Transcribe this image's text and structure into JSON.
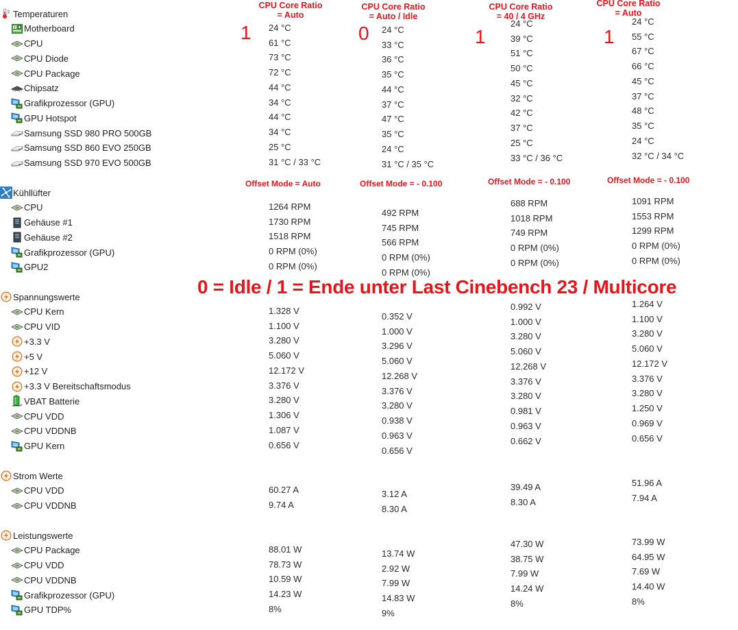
{
  "colors": {
    "annotation_red": "#e8141b",
    "text": "#1e1e1e"
  },
  "columns": [
    {
      "ratio_header": "CPU Core Ratio",
      "ratio_value": "= Auto",
      "marker": "1",
      "offset_label": "Offset Mode = Auto"
    },
    {
      "ratio_header": "CPU Core Ratio",
      "ratio_value": "= Auto / Idle",
      "marker": "0",
      "offset_label": "Offset Mode = - 0.100"
    },
    {
      "ratio_header": "CPU Core Ratio",
      "ratio_value": "= 40 / 4 GHz",
      "marker": "1",
      "offset_label": "Offset Mode = - 0.100"
    },
    {
      "ratio_header": "CPU Core Ratio",
      "ratio_value": "= Auto",
      "marker": "1",
      "offset_label": "Offset Mode = - 0.100"
    }
  ],
  "legend": "0 = Idle / 1 = Ende unter Last Cinebench 23 / Multicore",
  "sections": [
    {
      "title": "Temperaturen",
      "icon": "thermometer-icon",
      "items": [
        {
          "label": "Motherboard",
          "icon": "motherboard-icon",
          "values": [
            "24 °C",
            "24 °C",
            "24 °C",
            "24 °C"
          ]
        },
        {
          "label": "CPU",
          "icon": "cpu-icon",
          "values": [
            "61 °C",
            "33 °C",
            "39 °C",
            "55 °C"
          ]
        },
        {
          "label": "CPU Diode",
          "icon": "cpu-icon",
          "values": [
            "73 °C",
            "36 °C",
            "51 °C",
            "67 °C"
          ]
        },
        {
          "label": "CPU Package",
          "icon": "cpu-icon",
          "values": [
            "72 °C",
            "35 °C",
            "50 °C",
            "66 °C"
          ]
        },
        {
          "label": "Chipsatz",
          "icon": "chipset-icon",
          "values": [
            "44 °C",
            "44 °C",
            "45 °C",
            "45 °C"
          ]
        },
        {
          "label": "Grafikprozessor (GPU)",
          "icon": "gpu-icon",
          "values": [
            "34 °C",
            "37 °C",
            "32 °C",
            "37 °C"
          ]
        },
        {
          "label": "GPU Hotspot",
          "icon": "gpu-icon",
          "values": [
            "44 °C",
            "47 °C",
            "42 °C",
            "48 °C"
          ]
        },
        {
          "label": "Samsung SSD 980 PRO 500GB",
          "icon": "drive-icon",
          "values": [
            "34 °C",
            "35 °C",
            "37 °C",
            "35 °C"
          ]
        },
        {
          "label": "Samsung SSD 860 EVO 250GB",
          "icon": "drive-icon",
          "values": [
            "25 °C",
            "24 °C",
            "25 °C",
            "24 °C"
          ]
        },
        {
          "label": "Samsung SSD 970 EVO 500GB",
          "icon": "drive-icon",
          "values": [
            "31 °C / 33 °C",
            "31 °C / 35 °C",
            "33 °C / 36 °C",
            "32 °C / 34 °C"
          ]
        }
      ]
    },
    {
      "title": "Kühllüfter",
      "icon": "fan-icon",
      "items": [
        {
          "label": "CPU",
          "icon": "cpu-icon",
          "values": [
            "1264 RPM",
            "492 RPM",
            "688 RPM",
            "1091 RPM"
          ]
        },
        {
          "label": "Gehäuse #1",
          "icon": "case-icon",
          "values": [
            "1730 RPM",
            "745 RPM",
            "1018 RPM",
            "1553 RPM"
          ]
        },
        {
          "label": "Gehäuse #2",
          "icon": "case-icon",
          "values": [
            "1518 RPM",
            "566 RPM",
            "749 RPM",
            "1299 RPM"
          ]
        },
        {
          "label": "Grafikprozessor (GPU)",
          "icon": "gpu-icon",
          "values": [
            "0 RPM  (0%)",
            "0 RPM  (0%)",
            "0 RPM  (0%)",
            "0 RPM  (0%)"
          ]
        },
        {
          "label": "GPU2",
          "icon": "gpu-icon",
          "values": [
            "0 RPM  (0%)",
            "0 RPM  (0%)",
            "0 RPM  (0%)",
            "0 RPM  (0%)"
          ]
        }
      ]
    },
    {
      "title": "Spannungswerte",
      "icon": "voltage-icon",
      "items": [
        {
          "label": "CPU Kern",
          "icon": "cpu-icon",
          "values": [
            "1.328 V",
            "0.352 V",
            "0.992 V",
            "1.264 V"
          ]
        },
        {
          "label": "CPU VID",
          "icon": "cpu-icon",
          "values": [
            "1.100 V",
            "1.000 V",
            "1.000 V",
            "1.100 V"
          ]
        },
        {
          "label": "+3.3 V",
          "icon": "voltage-icon",
          "values": [
            "3.280 V",
            "3.296 V",
            "3.280 V",
            "3.280 V"
          ]
        },
        {
          "label": "+5 V",
          "icon": "voltage-icon",
          "values": [
            "5.060 V",
            "5.060 V",
            "5.060 V",
            "5.060 V"
          ]
        },
        {
          "label": "+12 V",
          "icon": "voltage-icon",
          "values": [
            "12.172 V",
            "12.268 V",
            "12.268 V",
            "12.172 V"
          ]
        },
        {
          "label": "+3.3 V Bereitschaftsmodus",
          "icon": "voltage-icon",
          "values": [
            "3.376 V",
            "3.376 V",
            "3.376 V",
            "3.376 V"
          ]
        },
        {
          "label": "VBAT Batterie",
          "icon": "battery-icon",
          "values": [
            "3.280 V",
            "3.280 V",
            "3.280 V",
            "3.280 V"
          ]
        },
        {
          "label": "CPU VDD",
          "icon": "cpu-icon",
          "values": [
            "1.306 V",
            "0.938 V",
            "0.981 V",
            "1.250 V"
          ]
        },
        {
          "label": "CPU VDDNB",
          "icon": "cpu-icon",
          "values": [
            "1.087 V",
            "0.963 V",
            "0.963 V",
            "0.969 V"
          ]
        },
        {
          "label": "GPU Kern",
          "icon": "gpu-icon",
          "values": [
            "0.656 V",
            "0.656 V",
            "0.662 V",
            "0.656 V"
          ]
        }
      ]
    },
    {
      "title": "Strom Werte",
      "icon": "voltage-icon",
      "items": [
        {
          "label": "CPU VDD",
          "icon": "cpu-icon",
          "values": [
            "60.27 A",
            "3.12 A",
            "39.49 A",
            "51.96 A"
          ]
        },
        {
          "label": "CPU VDDNB",
          "icon": "cpu-icon",
          "values": [
            "9.74 A",
            "8.30 A",
            "8.30 A",
            "7.94 A"
          ]
        }
      ]
    },
    {
      "title": "Leistungswerte",
      "icon": "voltage-icon",
      "items": [
        {
          "label": "CPU Package",
          "icon": "cpu-icon",
          "values": [
            "88.01 W",
            "13.74 W",
            "47.30 W",
            "73.99 W"
          ]
        },
        {
          "label": "CPU VDD",
          "icon": "cpu-icon",
          "values": [
            "78.73 W",
            "2.92 W",
            "38.75 W",
            "64.95 W"
          ]
        },
        {
          "label": "CPU VDDNB",
          "icon": "cpu-icon",
          "values": [
            "10.59 W",
            "7.99 W",
            "7.99 W",
            "7.69 W"
          ]
        },
        {
          "label": "Grafikprozessor (GPU)",
          "icon": "gpu-icon",
          "values": [
            "14.23 W",
            "14.83 W",
            "14.24 W",
            "14.40 W"
          ]
        },
        {
          "label": "GPU TDP%",
          "icon": "gpu-icon",
          "values": [
            "8%",
            "9%",
            "8%",
            "8%"
          ]
        }
      ]
    }
  ]
}
